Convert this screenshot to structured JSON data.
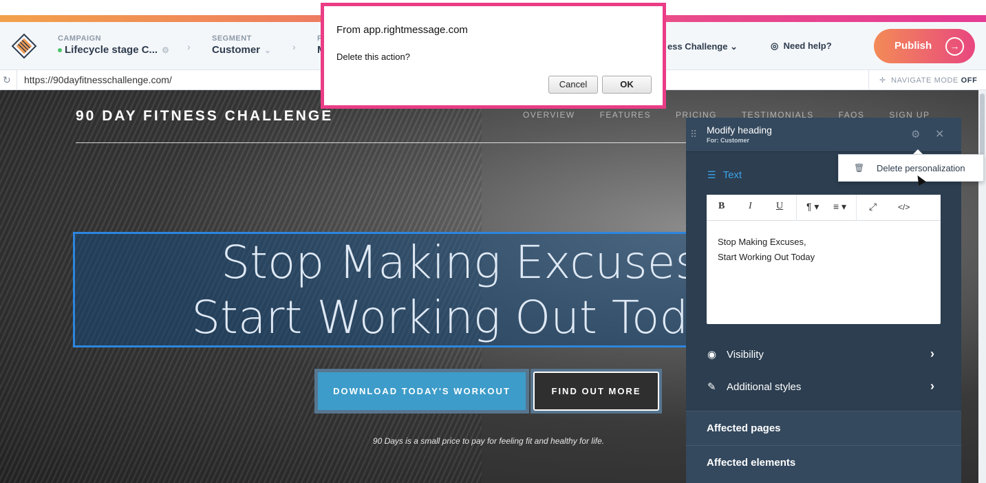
{
  "campaign": {
    "label": "CAMPAIGN",
    "value": "Lifecycle stage C..."
  },
  "segment": {
    "label": "SEGMENT",
    "value": "Customer"
  },
  "hidden_crumb": {
    "label_partial": "P",
    "value_partial": "M"
  },
  "project_partial": "ess Challenge",
  "help_label": "Need help?",
  "publish_label": "Publish",
  "url": "https://90dayfitnesschallenge.com/",
  "navigate_mode": {
    "label": "NAVIGATE MODE",
    "state": "OFF"
  },
  "site": {
    "title": "90 DAY FITNESS CHALLENGE",
    "nav": [
      "OVERVIEW",
      "FEATURES",
      "PRICING",
      "TESTIMONIALS",
      "FAQS",
      "SIGN UP"
    ],
    "headline_line1": "Stop Making Excuses,",
    "headline_line2": "Start Working Out Today",
    "primary_button": "DOWNLOAD TODAY'S WORKOUT",
    "secondary_button": "FIND OUT MORE",
    "tagline": "90 Days is a small price to pay for feeling fit and healthy for life."
  },
  "panel": {
    "title": "Modify heading",
    "subtitle": "For: Customer",
    "text_section": "Text",
    "editor_line1": "Stop Making Excuses,",
    "editor_line2": "Start Working Out Today",
    "toolbar": [
      "B",
      "I",
      "U",
      "¶",
      "≡",
      "⤢",
      "</>"
    ],
    "visibility": "Visibility",
    "additional_styles": "Additional styles",
    "affected_pages": "Affected pages",
    "affected_elements": "Affected elements"
  },
  "context_menu": {
    "delete_label": "Delete personalization"
  },
  "dialog": {
    "from": "From app.rightmessage.com",
    "message": "Delete this action?",
    "cancel": "Cancel",
    "ok": "OK"
  },
  "colors": {
    "accent": "#3ca3e8",
    "publish_start": "#f38b57",
    "publish_end": "#e8477f",
    "dialog_border": "#ea3d86",
    "panel": "#2c3e50"
  }
}
